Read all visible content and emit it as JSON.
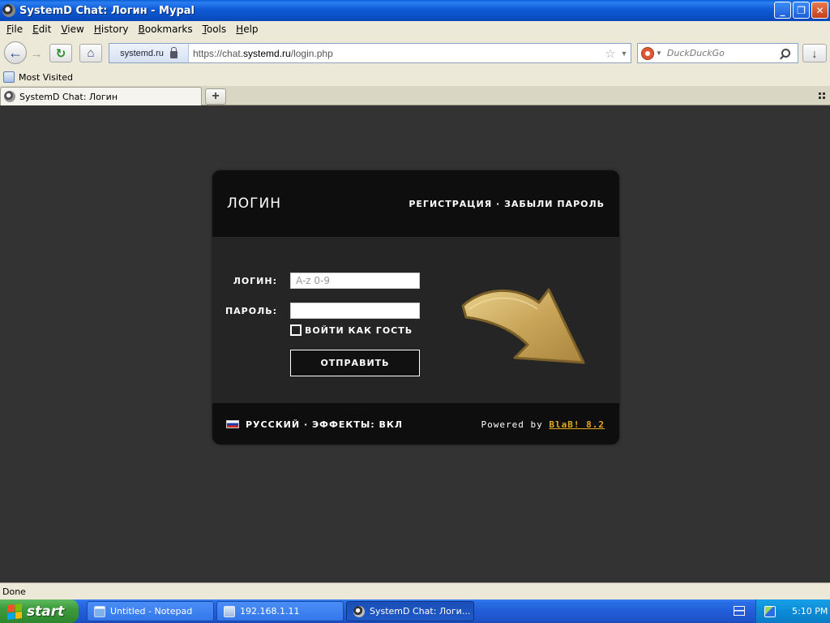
{
  "window": {
    "title": "SystemD Chat: Логин - Mypal",
    "minimize": "_",
    "maximize": "❐",
    "close": "✕"
  },
  "menu": [
    "File",
    "Edit",
    "View",
    "History",
    "Bookmarks",
    "Tools",
    "Help"
  ],
  "menu_access_keys": [
    "F",
    "E",
    "V",
    "H",
    "B",
    "T",
    "H"
  ],
  "nav": {
    "identity": "systemd.ru",
    "url_prefix": "https://chat.",
    "url_domain": "systemd.ru",
    "url_suffix": "/login.php",
    "search_placeholder": "DuckDuckGo"
  },
  "bookmarks": {
    "most_visited": "Most Visited"
  },
  "tab": {
    "label": "SystemD Chat: Логин",
    "new_tab": "+"
  },
  "login": {
    "title": "ЛОГИН",
    "register": "РЕГИСТРАЦИЯ",
    "separator": "·",
    "forgot": "ЗАБЫЛИ ПАРОЛЬ",
    "login_label": "ЛОГИН:",
    "login_placeholder": "A-z 0-9",
    "password_label": "ПАРОЛЬ:",
    "password_value": "",
    "guest_label": "ВОЙТИ КАК ГОСТЬ",
    "guest_checked": false,
    "submit": "ОТПРАВИТЬ",
    "language": "РУССКИЙ",
    "effects": "ЭФФЕКТЫ: ВКЛ",
    "powered_by": "Powered by",
    "engine": "BlaB! 8.2",
    "colors": {
      "page_bg": "#333333",
      "box_bg": "#202020",
      "header_bg": "#0e0e0e",
      "link_accent": "#e3a81d",
      "arrow_gold": "#c9a55a"
    }
  },
  "status": {
    "text": "Done"
  },
  "taskbar": {
    "start": "start",
    "tasks": [
      {
        "label": "Untitled - Notepad",
        "icon": "notepad-icon"
      },
      {
        "label": "192.168.1.11",
        "icon": "network-icon"
      },
      {
        "label": "SystemD Chat: Логи...",
        "icon": "chat-icon"
      }
    ],
    "clock": "5:10 PM"
  }
}
